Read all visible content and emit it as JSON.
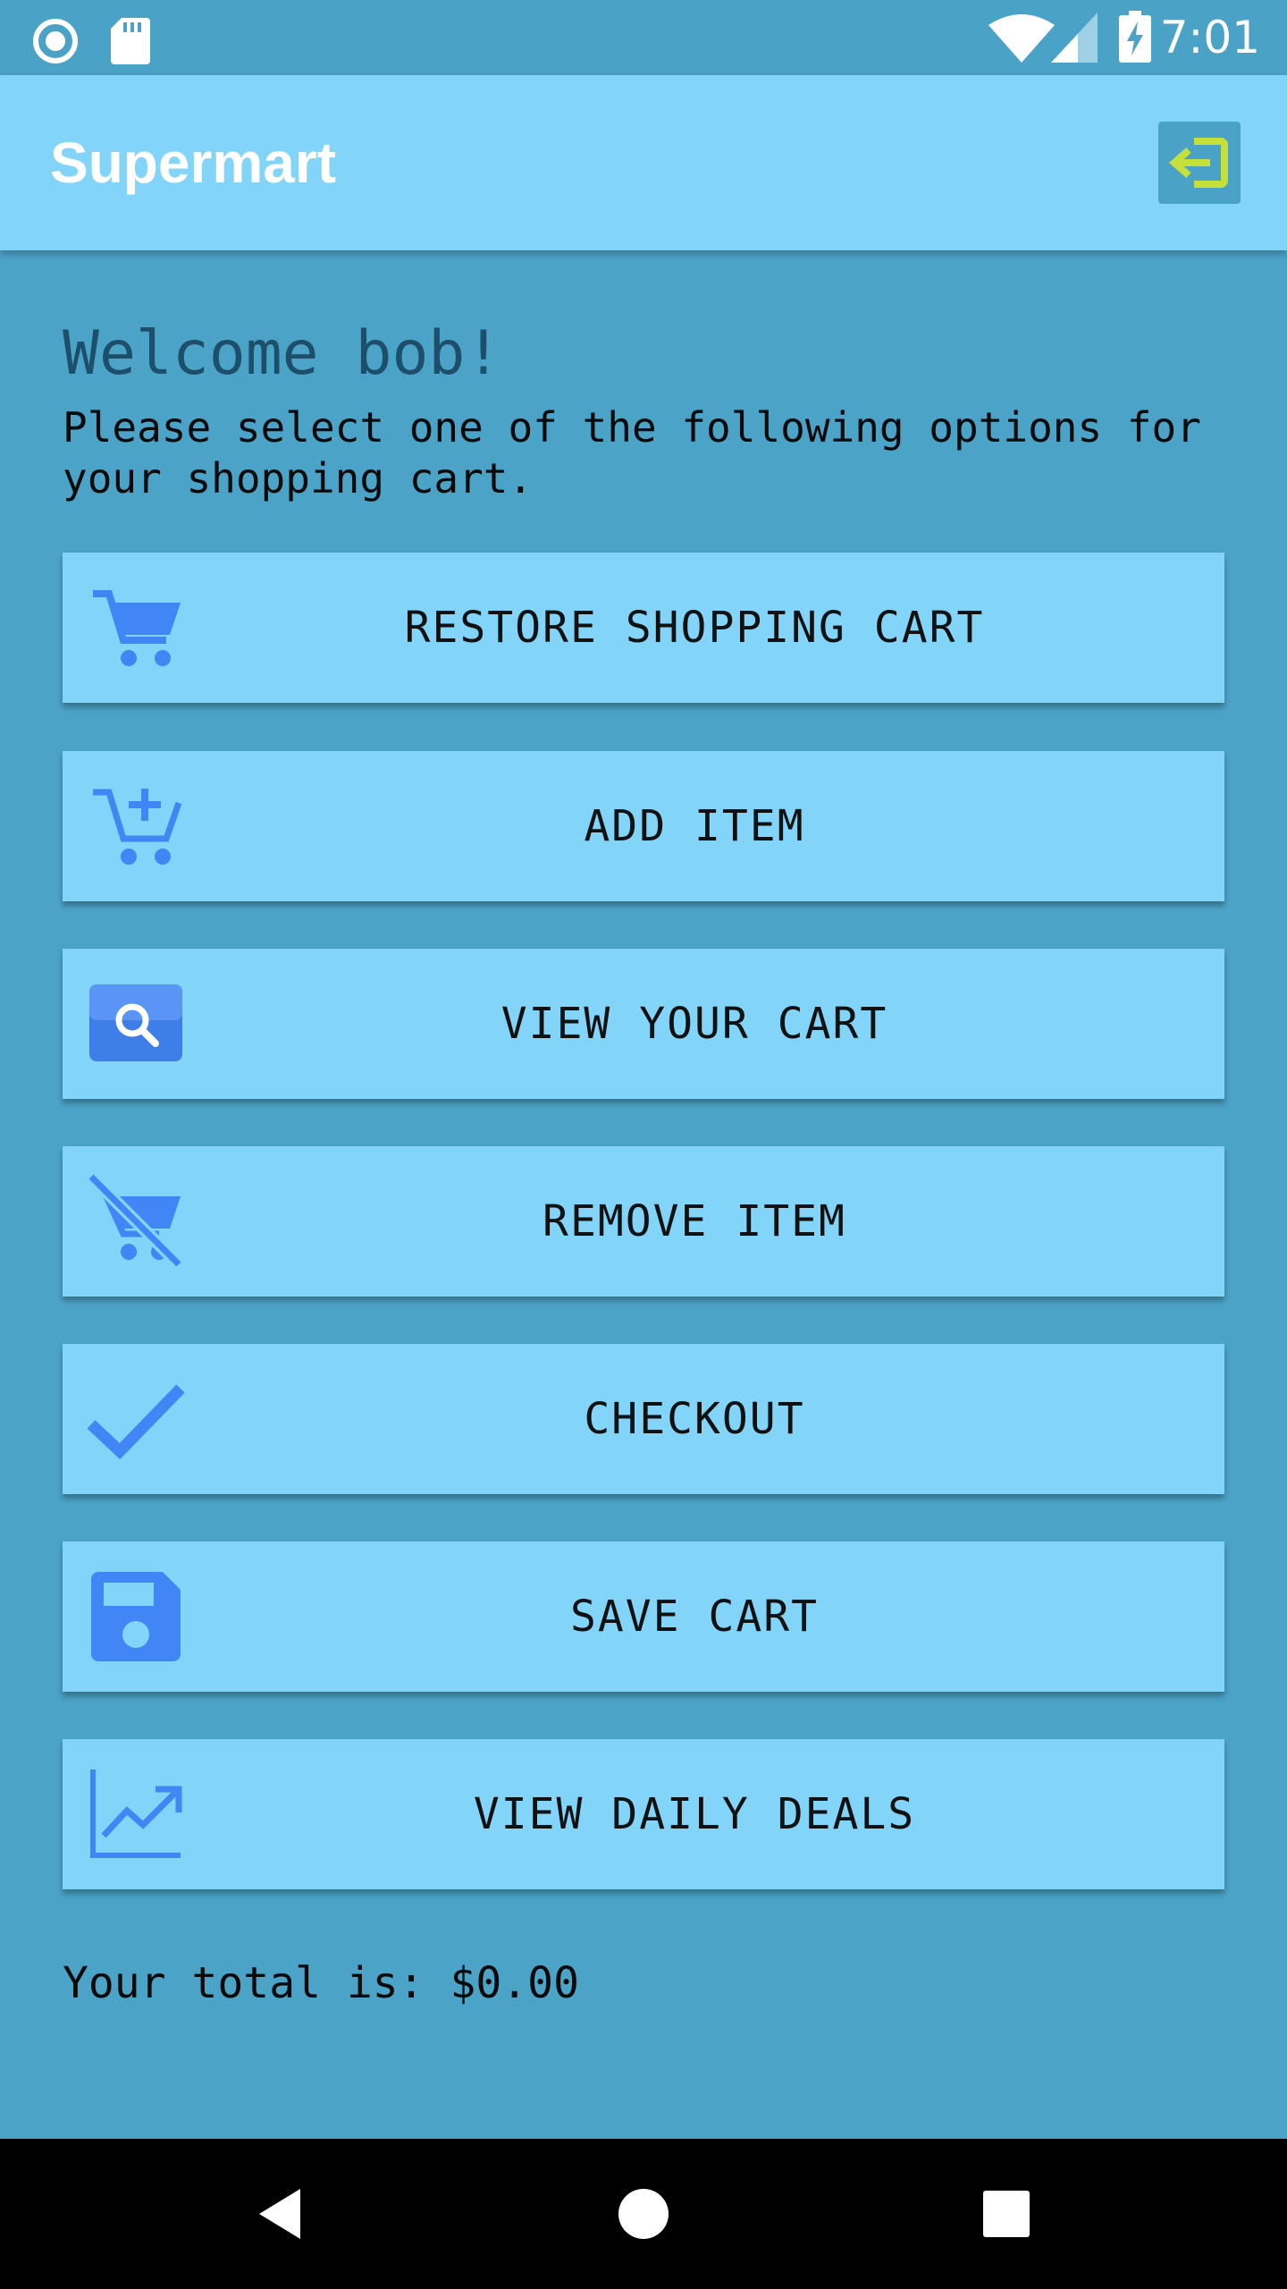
{
  "status_bar": {
    "time": "7:01",
    "left_icons": [
      "record-icon",
      "sd-card-icon"
    ],
    "right_icons": [
      "wifi-icon",
      "signal-icon",
      "battery-charging-icon"
    ]
  },
  "app_bar": {
    "title": "Supermart",
    "logout_icon": "logout-icon"
  },
  "main": {
    "welcome": "Welcome bob!",
    "instructions": "Please select one of the following options for your shopping cart.",
    "options": [
      {
        "label": "RESTORE SHOPPING CART",
        "icon": "shopping-cart-icon"
      },
      {
        "label": "ADD ITEM",
        "icon": "add-shopping-cart-icon"
      },
      {
        "label": "VIEW YOUR CART",
        "icon": "search-icon"
      },
      {
        "label": "REMOVE ITEM",
        "icon": "remove-shopping-cart-icon"
      },
      {
        "label": "CHECKOUT",
        "icon": "checkmark-icon"
      },
      {
        "label": "SAVE CART",
        "icon": "save-icon"
      },
      {
        "label": "VIEW DAILY DEALS",
        "icon": "trending-up-icon"
      }
    ],
    "total": "Your total is: $0.00"
  },
  "colors": {
    "background": "#4ba3c7",
    "app_bar": "#82d4f8",
    "button": "#82d4f8",
    "icon_blue": "#4285f4",
    "logout_bg": "#4aa3c7",
    "logout_arrow": "#c6e03a"
  },
  "nav_bar": {
    "icons": [
      "back-icon",
      "home-icon",
      "recents-icon"
    ]
  }
}
